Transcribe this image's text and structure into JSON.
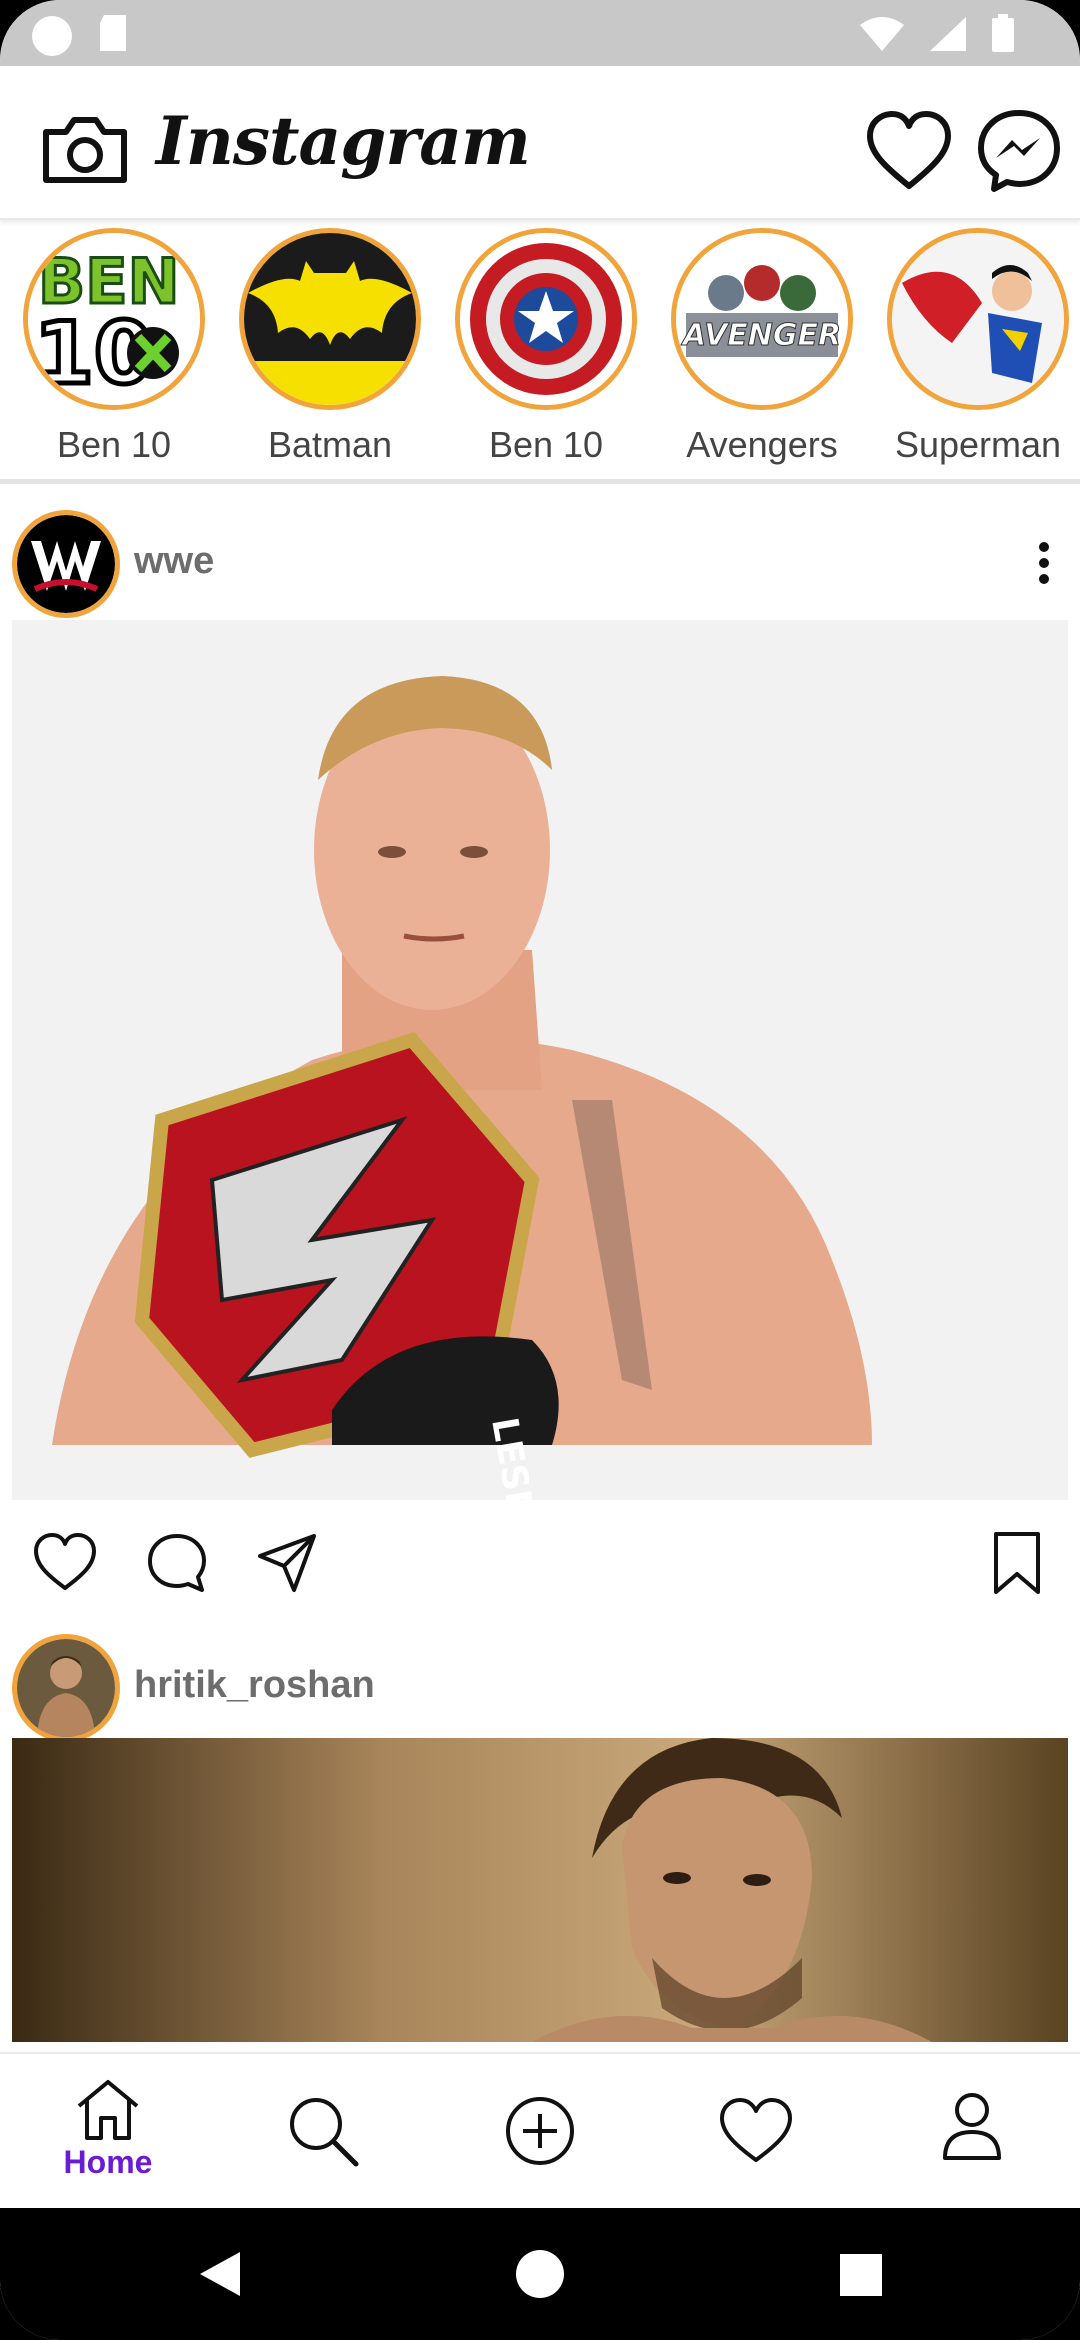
{
  "app": {
    "title": "Instagram"
  },
  "stories": [
    {
      "label": "Ben 10"
    },
    {
      "label": "Batman"
    },
    {
      "label": "Ben 10"
    },
    {
      "label": "Avengers"
    },
    {
      "label": "Superman"
    }
  ],
  "posts": [
    {
      "username": "wwe"
    },
    {
      "username": "hritik_roshan"
    }
  ],
  "bottom_nav": {
    "home_label": "Home",
    "active_color": "#6a1bd6"
  },
  "colors": {
    "story_ring": "#f2a43c",
    "status_bar": "#c8c8c8"
  }
}
